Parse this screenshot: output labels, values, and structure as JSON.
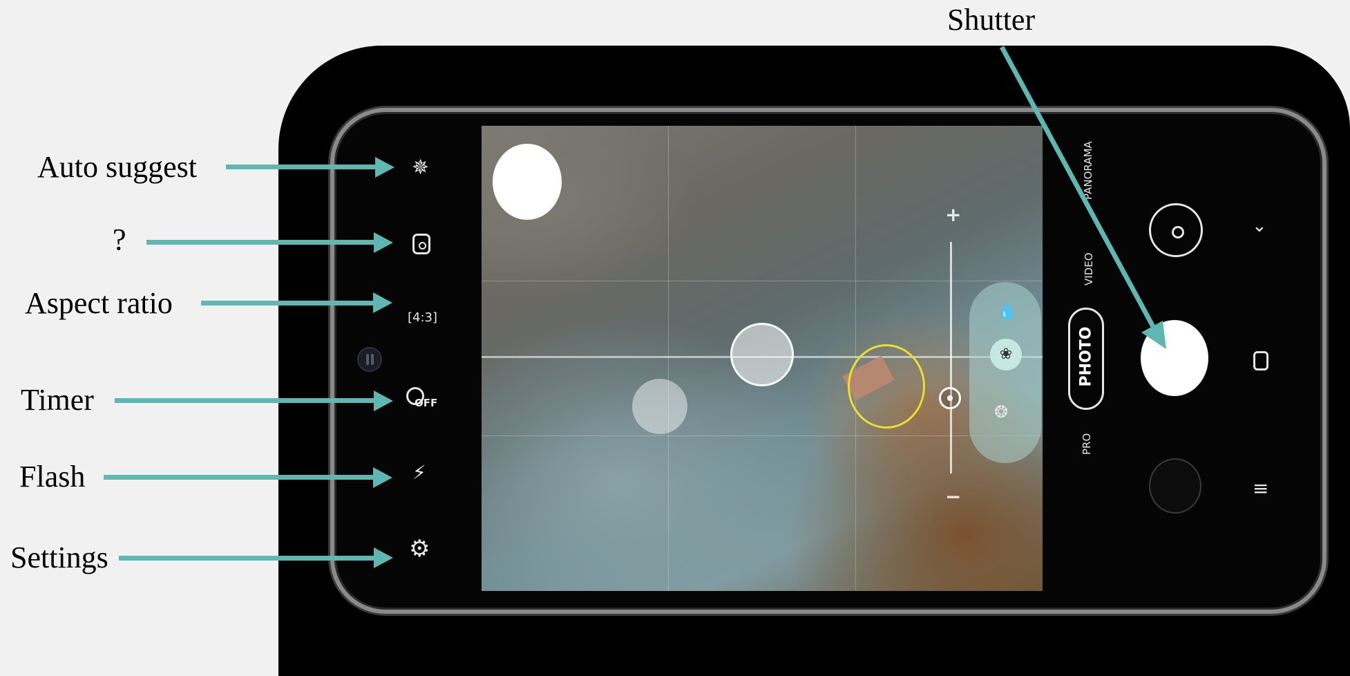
{
  "annotations": {
    "shutter": "Shutter",
    "auto_suggest": "Auto suggest",
    "unknown": "?",
    "aspect_ratio": "Aspect ratio",
    "timer": "Timer",
    "flash": "Flash",
    "settings": "Settings"
  },
  "camera": {
    "left_toolbar": [
      {
        "icon": "sparkle-icon"
      },
      {
        "icon": "motion-photo-icon"
      },
      {
        "icon": "aspect-ratio-icon",
        "label": "4:3"
      },
      {
        "icon": "timer-icon",
        "label": "OFF"
      },
      {
        "icon": "flash-off-icon"
      },
      {
        "icon": "gear-icon"
      }
    ],
    "zoom": {
      "plus": "+",
      "minus": "−"
    },
    "modes": [
      "PANORAMA",
      "VIDEO",
      "PHOTO",
      "PRO"
    ],
    "selected_mode": "PHOTO"
  },
  "colors": {
    "arrow": "#5fb7b1",
    "background": "#f1f1f1",
    "focus_ring": "#e8e12a"
  }
}
